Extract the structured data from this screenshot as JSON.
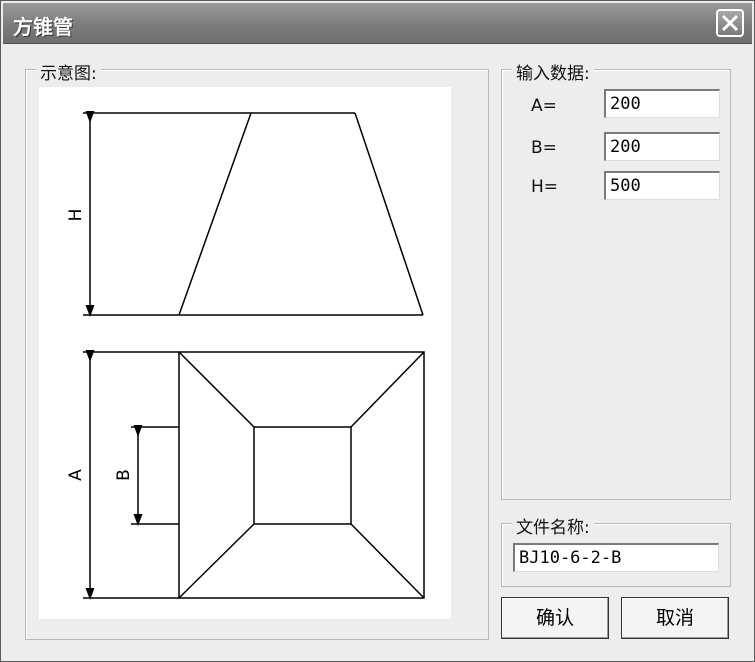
{
  "window": {
    "title": "方锥管"
  },
  "diagram_group": {
    "label": "示意图:",
    "dimension_labels": {
      "h": "H",
      "a": "A",
      "b": "B"
    }
  },
  "input_group": {
    "label": "输入数据:",
    "fields": [
      {
        "label": "A=",
        "value": "200"
      },
      {
        "label": "B=",
        "value": "200"
      },
      {
        "label": "H=",
        "value": "500"
      }
    ]
  },
  "file_group": {
    "label": "文件名称:",
    "value": "BJ10-6-2-B"
  },
  "buttons": {
    "ok": "确认",
    "cancel": "取消"
  }
}
